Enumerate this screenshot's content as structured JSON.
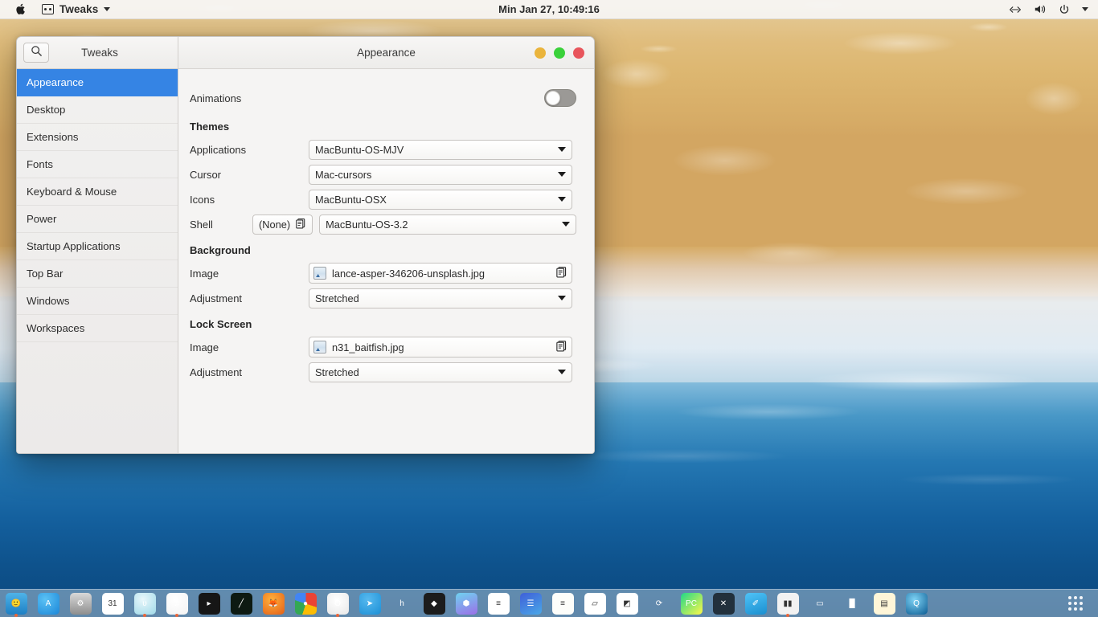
{
  "topbar": {
    "apple_logo": "apple-logo",
    "app_name": "Tweaks",
    "clock": "Min Jan 27, 10:49:16",
    "tray": [
      "network-icon",
      "volume-icon",
      "power-icon",
      "chevron-down-icon"
    ]
  },
  "window": {
    "title": "Appearance",
    "controls": [
      {
        "name": "minimize",
        "color": "#eab43c"
      },
      {
        "name": "maximize",
        "color": "#3ad13a"
      },
      {
        "name": "close",
        "color": "#e8555c"
      }
    ]
  },
  "sidebar": {
    "title": "Tweaks",
    "search_icon": "search-icon",
    "items": [
      {
        "label": "Appearance",
        "active": true
      },
      {
        "label": "Desktop",
        "active": false
      },
      {
        "label": "Extensions",
        "active": false
      },
      {
        "label": "Fonts",
        "active": false
      },
      {
        "label": "Keyboard & Mouse",
        "active": false
      },
      {
        "label": "Power",
        "active": false
      },
      {
        "label": "Startup Applications",
        "active": false
      },
      {
        "label": "Top Bar",
        "active": false
      },
      {
        "label": "Windows",
        "active": false
      },
      {
        "label": "Workspaces",
        "active": false
      }
    ],
    "accent_color": "#3584e4"
  },
  "main": {
    "animations": {
      "label": "Animations",
      "enabled": false
    },
    "themes": {
      "heading": "Themes",
      "rows": [
        {
          "label": "Applications",
          "value": "MacBuntu-OS-MJV"
        },
        {
          "label": "Cursor",
          "value": "Mac-cursors"
        },
        {
          "label": "Icons",
          "value": "MacBuntu-OSX"
        }
      ],
      "shell": {
        "label": "Shell",
        "none_label": "(None)",
        "value": "MacBuntu-OS-3.2"
      }
    },
    "background": {
      "heading": "Background",
      "image_label": "Image",
      "image_value": "lance-asper-346206-unsplash.jpg",
      "adjustment_label": "Adjustment",
      "adjustment_value": "Stretched"
    },
    "lockscreen": {
      "heading": "Lock Screen",
      "image_label": "Image",
      "image_value": "n31_baitfish.jpg",
      "adjustment_label": "Adjustment",
      "adjustment_value": "Stretched"
    }
  },
  "dock": {
    "items": [
      {
        "name": "finder",
        "glyph": "🙂",
        "bg": "linear-gradient(180deg,#4fb3e8,#1d7fc4)",
        "running": true
      },
      {
        "name": "app-store",
        "glyph": "A",
        "bg": "radial-gradient(circle at 35% 30%,#5bc2f5,#1a86d8)",
        "running": false
      },
      {
        "name": "system-settings",
        "glyph": "⚙",
        "bg": "linear-gradient(180deg,#d8d8d8,#8e8e8e)",
        "running": false
      },
      {
        "name": "calendar",
        "glyph": "31",
        "bg": "#ffffff",
        "running": false
      },
      {
        "name": "audio-mixer",
        "glyph": "ᴜ",
        "bg": "radial-gradient(circle at 40% 30%,#e9f7fb,#9fd9e8)",
        "running": true
      },
      {
        "name": "music",
        "glyph": "♫",
        "bg": "radial-gradient(circle at 40% 30%,#ffffff,#f3f3f3)",
        "running": true
      },
      {
        "name": "terminal",
        "glyph": "▸",
        "bg": "#161616",
        "running": false
      },
      {
        "name": "system-monitor",
        "glyph": "╱",
        "bg": "#0d1a12",
        "running": false
      },
      {
        "name": "firefox",
        "glyph": "🦊",
        "bg": "radial-gradient(circle at 40% 32%,#ffb13b,#e35f17)",
        "running": false
      },
      {
        "name": "chrome",
        "glyph": "●",
        "bg": "conic-gradient(#ea4335 0 30%,#fbbc05 30% 55%,#34a853 55% 80%,#4285f4 80% 100%)",
        "running": false
      },
      {
        "name": "opera",
        "glyph": "O",
        "bg": "radial-gradient(circle at 45% 35%,#ffffff,#e8e8e8)",
        "running": true
      },
      {
        "name": "telegram",
        "glyph": "➤",
        "bg": "radial-gradient(circle at 40% 30%,#57b9ef,#1b8fd6)",
        "running": false
      },
      {
        "name": "handbrake",
        "glyph": "h",
        "bg": "transparent",
        "running": false
      },
      {
        "name": "inkscape",
        "glyph": "◆",
        "bg": "#1c1c1c",
        "running": false
      },
      {
        "name": "hexagon-app",
        "glyph": "⬢",
        "bg": "linear-gradient(160deg,#6fd3f0,#9b6fe8)",
        "running": false
      },
      {
        "name": "notes",
        "glyph": "≡",
        "bg": "#ffffff",
        "running": false
      },
      {
        "name": "blue-book",
        "glyph": "☰",
        "bg": "linear-gradient(150deg,#3f5fd8,#4aa8e8)",
        "running": false
      },
      {
        "name": "notepad",
        "glyph": "≡",
        "bg": "#fdfdfa",
        "running": false
      },
      {
        "name": "paper-stack",
        "glyph": "▱",
        "bg": "#ffffff",
        "running": false
      },
      {
        "name": "image-editor",
        "glyph": "◩",
        "bg": "#ffffff",
        "running": false
      },
      {
        "name": "sync",
        "glyph": "⟳",
        "bg": "transparent",
        "running": false
      },
      {
        "name": "pycharm",
        "glyph": "PC",
        "bg": "linear-gradient(135deg,#21d789,#fcf84a)",
        "running": false
      },
      {
        "name": "vscode",
        "glyph": "✕",
        "bg": "#22303c",
        "running": false
      },
      {
        "name": "brush-app",
        "glyph": "✐",
        "bg": "linear-gradient(160deg,#4fc3f7,#1a8fd0)",
        "running": false
      },
      {
        "name": "audio-rack",
        "glyph": "▮▮",
        "bg": "#f2f2f2",
        "running": true
      },
      {
        "name": "presentation",
        "glyph": "▭",
        "bg": "transparent",
        "running": false
      },
      {
        "name": "charts",
        "glyph": "█",
        "bg": "transparent",
        "running": false
      },
      {
        "name": "document",
        "glyph": "▤",
        "bg": "#fff6d8",
        "running": false
      },
      {
        "name": "quicktime",
        "glyph": "Q",
        "bg": "radial-gradient(circle at 40% 32%,#7fd3f5,#0b5c93)",
        "running": false
      }
    ],
    "launcher": {
      "name": "app-grid-launcher",
      "glyph": "app-grid-icon"
    }
  }
}
